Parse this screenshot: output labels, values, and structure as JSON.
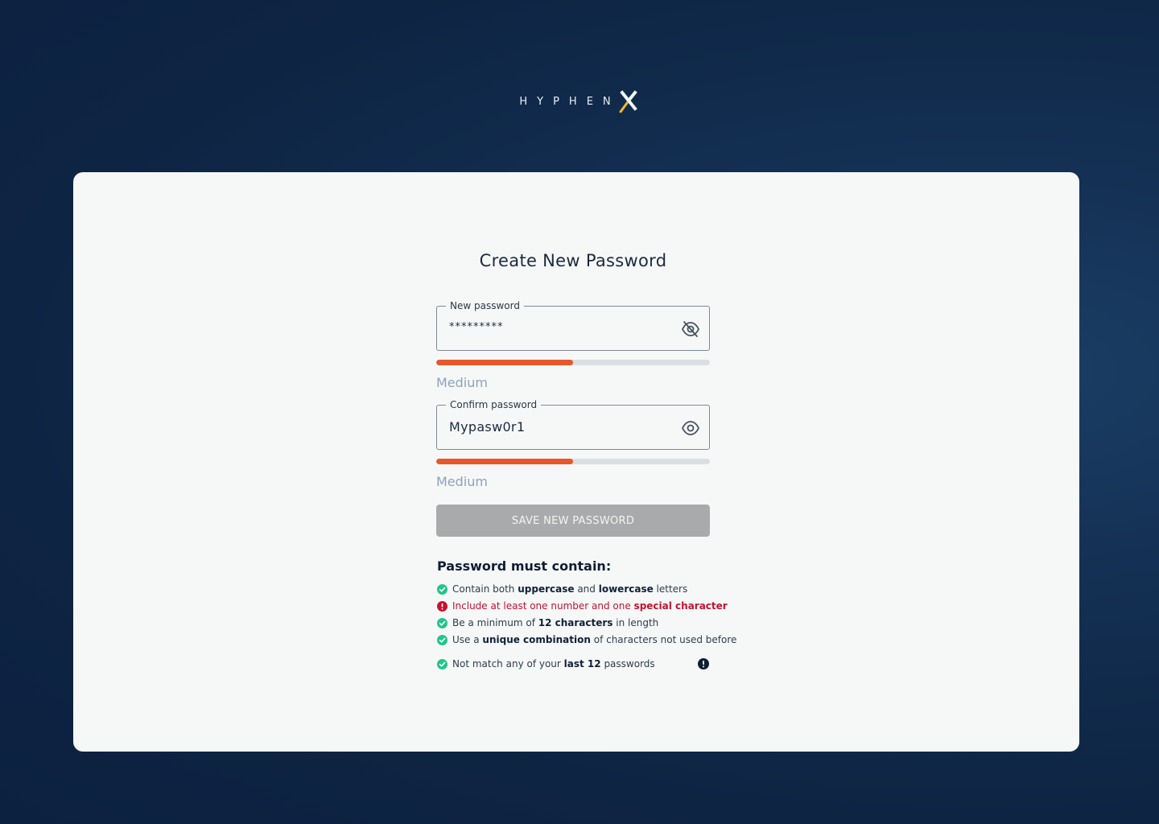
{
  "brand": {
    "name": "HYPHEN",
    "mark": "X",
    "accent_color": "#f1b82d"
  },
  "title": "Create New Password",
  "new_password": {
    "label": "New password",
    "value": "*********",
    "toggle_icon": "eye-off-icon",
    "strength_fraction": 0.5,
    "strength_label": "Medium"
  },
  "confirm_password": {
    "label": "Confirm password",
    "value": "Mypasw0r1",
    "toggle_icon": "eye-icon",
    "strength_fraction": 0.5,
    "strength_label": "Medium"
  },
  "colors": {
    "strength_medium": "#e8572a",
    "success": "#22c58a",
    "error": "#c4122f",
    "button_disabled": "#a9aaab"
  },
  "save_button": {
    "label": "SAVE NEW PASSWORD",
    "disabled": true
  },
  "requirements": {
    "heading": "Password must contain:",
    "items": [
      {
        "status": "ok",
        "parts": [
          {
            "t": "Contain both "
          },
          {
            "b": "uppercase"
          },
          {
            "t": " and "
          },
          {
            "b": "lowercase"
          },
          {
            "t": " letters"
          }
        ]
      },
      {
        "status": "error",
        "parts": [
          {
            "t": "Include at least one number and one "
          },
          {
            "b": "special character"
          }
        ]
      },
      {
        "status": "ok",
        "parts": [
          {
            "t": "Be a minimum of "
          },
          {
            "b": "12 characters"
          },
          {
            "t": " in length"
          }
        ]
      },
      {
        "status": "ok",
        "parts": [
          {
            "t": "Use a "
          },
          {
            "b": "unique combination"
          },
          {
            "t": " of characters not used before"
          }
        ]
      },
      {
        "status": "ok",
        "parts": [
          {
            "t": "Not match any of your "
          },
          {
            "b": "last 12"
          },
          {
            "t": " passwords"
          }
        ],
        "info_icon": "info-icon"
      }
    ]
  }
}
